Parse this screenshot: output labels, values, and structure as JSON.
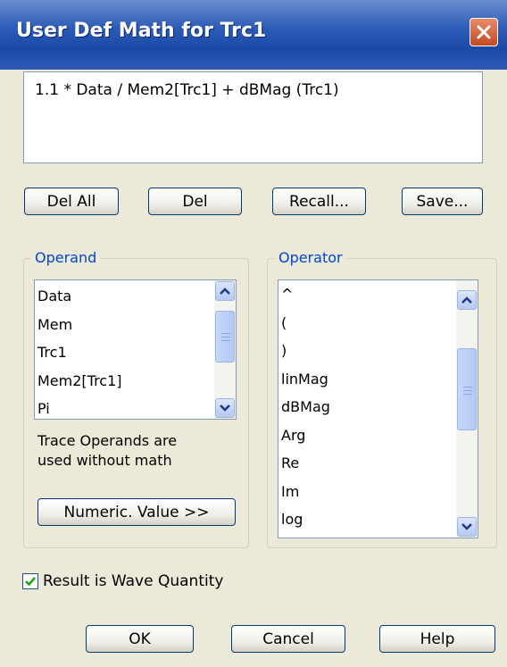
{
  "window": {
    "title": "User Def Math for Trc1",
    "close_icon": "close-icon"
  },
  "formula": {
    "value": "1.1 * Data / Mem2[Trc1] + dBMag (Trc1)"
  },
  "edit_buttons": {
    "del_all": "Del All",
    "del": "Del",
    "recall": "Recall...",
    "save": "Save..."
  },
  "operand": {
    "label": "Operand",
    "items": [
      "Data",
      "Mem",
      "Trc1",
      "Mem2[Trc1]",
      "Pi"
    ],
    "note_line1": "Trace Operands are",
    "note_line2": "used without math",
    "numeric_button": "Numeric. Value >>"
  },
  "operator": {
    "label": "Operator",
    "items": [
      "^",
      "(",
      ")",
      "linMag",
      "dBMag",
      "Arg",
      "Re",
      "Im",
      "log"
    ]
  },
  "result_wave": {
    "label": "Result is Wave Quantity",
    "checked": true
  },
  "footer": {
    "ok": "OK",
    "cancel": "Cancel",
    "help": "Help"
  },
  "colors": {
    "title_bar": "#2d5bb8",
    "group_label": "#0046d5",
    "face": "#ece9d8",
    "close_button": "#c44a22"
  }
}
